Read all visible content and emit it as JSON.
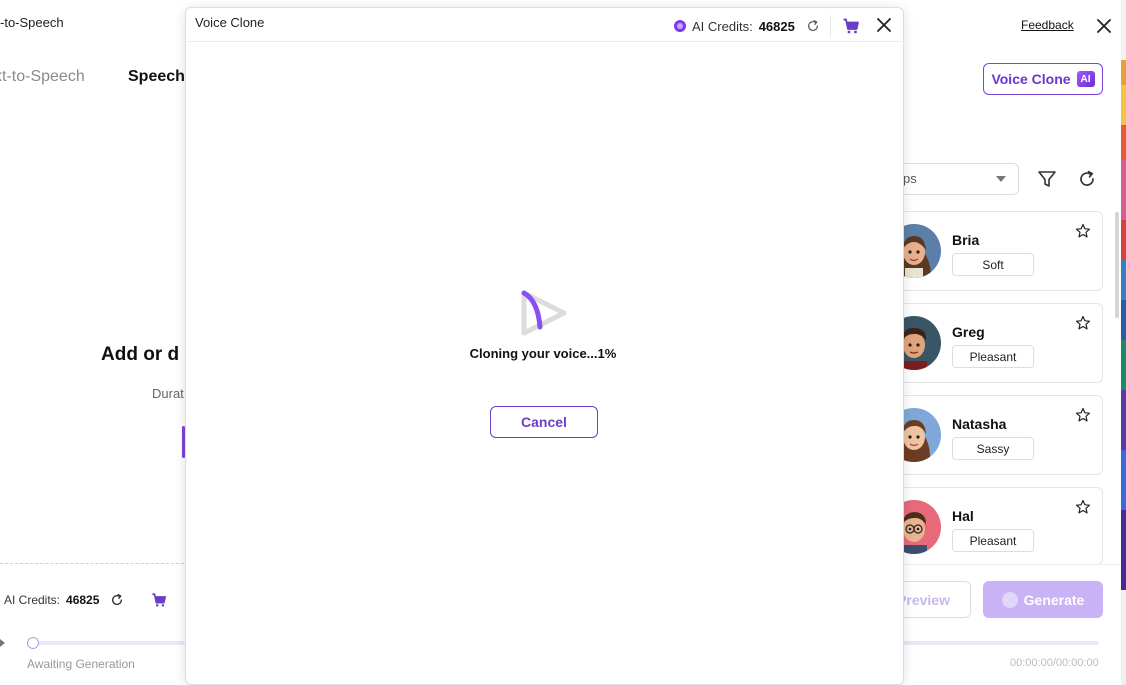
{
  "app": {
    "window_title": "-to-Speech",
    "feedback_label": "Feedback",
    "tabs": [
      {
        "label": "xt-to-Speech",
        "active": false
      },
      {
        "label": "Speech",
        "active": true
      }
    ],
    "voice_clone_button": {
      "label": "Voice Clone",
      "badge": "AI"
    },
    "upload_area": {
      "title": "Add or d",
      "duration_hint": "Durat"
    },
    "voice_filter": {
      "selected": "ps"
    },
    "voices": [
      {
        "name": "Bria",
        "tag": "Soft",
        "avatar_bg": "#5b7fa8",
        "skin": "#e8b08c",
        "hair": "#5a3a22"
      },
      {
        "name": "Greg",
        "tag": "Pleasant",
        "avatar_bg": "#3a5566",
        "skin": "#e1a57c",
        "hair": "#3b2416"
      },
      {
        "name": "Natasha",
        "tag": "Sassy",
        "avatar_bg": "#7fa8d8",
        "skin": "#f0c3a2",
        "hair": "#6b3d22"
      },
      {
        "name": "Hal",
        "tag": "Pleasant",
        "avatar_bg": "#e66a7a",
        "skin": "#e9b48f",
        "hair": "#4a2e1c"
      }
    ],
    "footer": {
      "credits_label": "AI Credits:",
      "credits_value": "46825",
      "preview_label": "Preview",
      "generate_label": "Generate",
      "status": "Awaiting Generation",
      "time": "00:00:00/00:00:00"
    }
  },
  "modal": {
    "title": "Voice Clone",
    "credits_label": "AI Credits:",
    "credits_value": "46825",
    "progress_text": "Cloning your voice...1%",
    "progress_percent": 1,
    "cancel_label": "Cancel"
  },
  "colors": {
    "accent": "#6b3fc5",
    "accent_light": "#c9b2f5",
    "text": "#111111"
  },
  "icons": [
    "close-icon",
    "refresh-icon",
    "cart-icon",
    "filter-icon",
    "star-icon",
    "chevron-down-icon",
    "loading-spinner-icon",
    "play-icon",
    "ai-credits-icon"
  ]
}
